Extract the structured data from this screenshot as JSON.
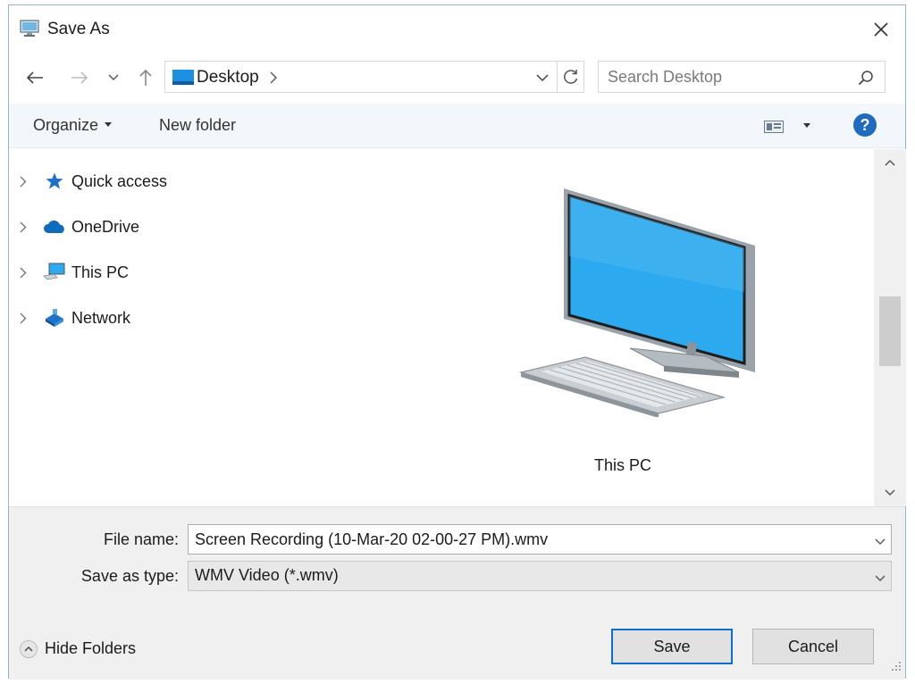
{
  "window": {
    "title": "Save As",
    "icons": {
      "title": "computer-save-icon",
      "close": "close-icon"
    }
  },
  "nav": {
    "back": "back-arrow-icon",
    "forward": "forward-arrow-icon",
    "recent": "chevron-down-icon",
    "up": "up-arrow-icon",
    "address": {
      "location": "Desktop",
      "icon": "desktop-icon"
    },
    "refresh": "refresh-icon",
    "search": {
      "placeholder": "Search Desktop",
      "value": "",
      "icon": "search-icon"
    }
  },
  "commands": {
    "organize": "Organize",
    "new_folder": "New folder",
    "view_icon": "view-options-icon",
    "help": "?"
  },
  "tree": {
    "items": [
      {
        "label": "Quick access",
        "icon": "star-icon"
      },
      {
        "label": "OneDrive",
        "icon": "cloud-icon"
      },
      {
        "label": "This PC",
        "icon": "computer-icon"
      },
      {
        "label": "Network",
        "icon": "network-icon"
      }
    ]
  },
  "content": {
    "items": [
      {
        "label": "This PC",
        "icon": "computer-icon"
      }
    ]
  },
  "form": {
    "file_name_label": "File name:",
    "file_name_value": "Screen Recording (10-Mar-20 02-00-27 PM).wmv",
    "save_type_label": "Save as type:",
    "save_type_value": "WMV Video (*.wmv)"
  },
  "footer": {
    "hide_folders": "Hide Folders",
    "save": "Save",
    "cancel": "Cancel"
  },
  "colors": {
    "accent": "#0a6fd1",
    "help": "#1f6bc0",
    "screen": "#29a8f0",
    "border": "#8fb7c9"
  }
}
